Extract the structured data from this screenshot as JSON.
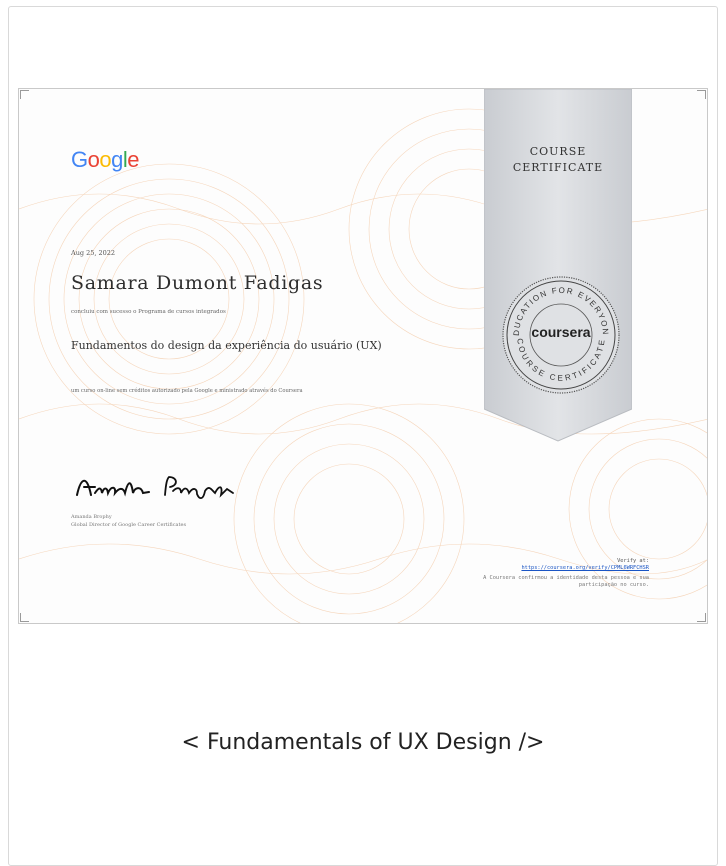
{
  "certificate": {
    "issuer_logo": {
      "G": "G",
      "o1": "o",
      "o2": "o",
      "g": "g",
      "l": "l",
      "e": "e"
    },
    "logo_colors": [
      "#4285F4",
      "#EA4335",
      "#FBBC05",
      "#4285F4",
      "#34A853",
      "#EA4335"
    ],
    "date": "Aug 25, 2022",
    "recipient_name": "Samara Dumont Fadigas",
    "completion_text": "concluiu com sucesso o Programa de cursos integrados",
    "course_title": "Fundamentos do design da experiência do usuário (UX)",
    "description": "um curso on-line sem créditos autorizado pela Google e ministrado através do Coursera",
    "signer_name": "Amanda Brophy",
    "signer_title": "Global Director of Google Career Certificates",
    "ribbon_line1": "COURSE",
    "ribbon_line2": "CERTIFICATE",
    "seal_brand": "coursera",
    "seal_top_text": "EDUCATION FOR EVERYONE",
    "seal_bottom_text": "COURSE CERTIFICATE",
    "verify_label": "Verify at:",
    "verify_url": "https://coursera.org/verify/CPML6WRFCHSR",
    "verify_note": "A Coursera confirmou a identidade desta pessoa e sua participação no curso."
  },
  "caption": "< Fundamentals of UX Design />"
}
